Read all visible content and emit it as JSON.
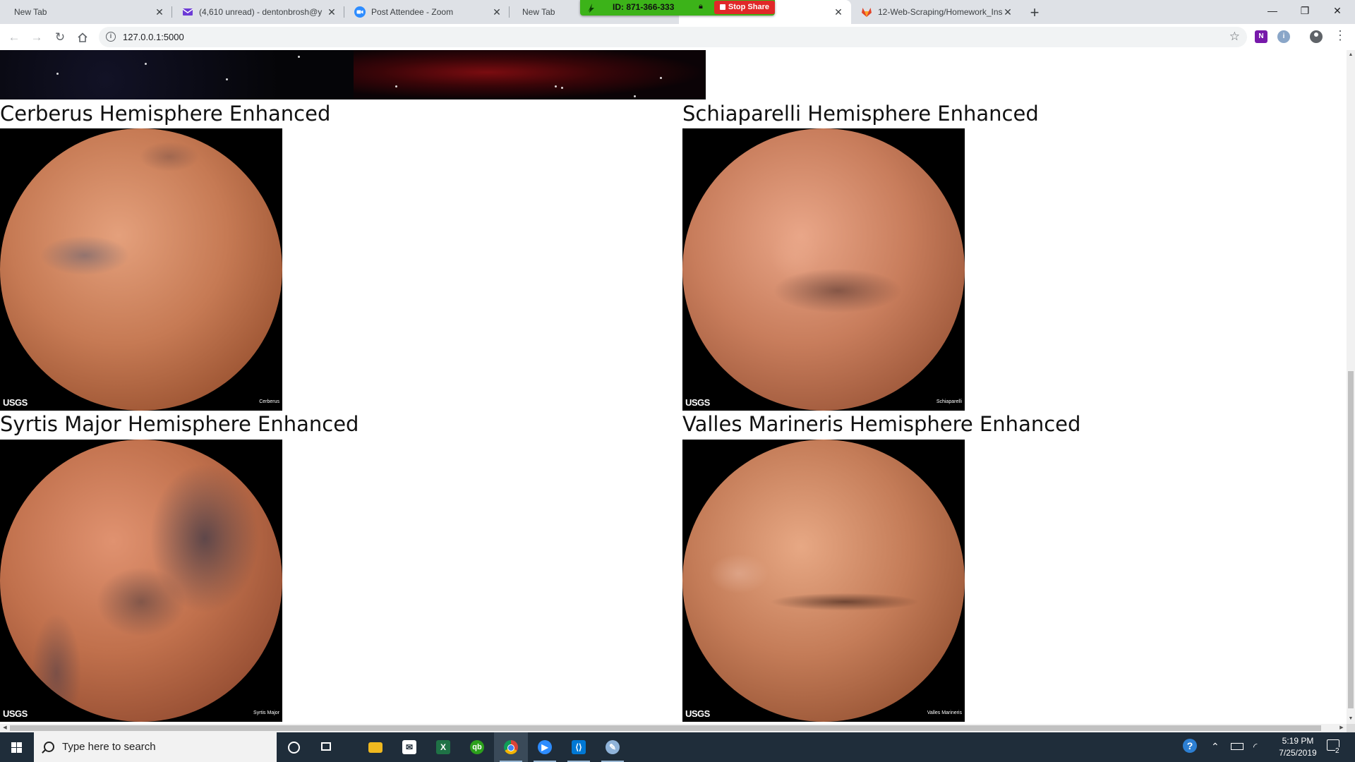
{
  "browser": {
    "tabs": [
      {
        "title": "New Tab",
        "icon": "none",
        "active": false
      },
      {
        "title": "(4,610 unread) - dentonbrosh@y",
        "icon": "yahoo-mail-icon",
        "active": false
      },
      {
        "title": "Post Attendee - Zoom",
        "icon": "zoom-icon",
        "active": false
      },
      {
        "title": "New Tab",
        "icon": "none",
        "active": false
      },
      {
        "title": "",
        "icon": "none",
        "active": true
      },
      {
        "title": "12-Web-Scraping/Homework_Ins",
        "icon": "gitlab-icon",
        "active": false
      }
    ],
    "address": "127.0.0.1:5000"
  },
  "zoom_share": {
    "meeting_id": "ID: 871-366-333",
    "stop_label": "Stop Share"
  },
  "page": {
    "hemispheres": [
      {
        "title": "Cerberus Hemisphere Enhanced",
        "image_label": "Cerberus",
        "image_logo": "USGS"
      },
      {
        "title": "Schiaparelli Hemisphere Enhanced",
        "image_label": "Schiaparelli",
        "image_logo": "USGS"
      },
      {
        "title": "Syrtis Major Hemisphere Enhanced",
        "image_label": "Syrtis Major",
        "image_logo": "USGS"
      },
      {
        "title": "Valles Marineris Hemisphere Enhanced",
        "image_label": "Valles Marineris",
        "image_logo": "USGS"
      }
    ]
  },
  "taskbar": {
    "search_placeholder": "Type here to search",
    "time": "5:19 PM",
    "date": "7/25/2019",
    "notification_count": "2"
  },
  "colors": {
    "zoom_green": "#3cb319",
    "stop_red": "#e02828",
    "taskbar": "#1f2d3a",
    "mars": "#c07048"
  }
}
